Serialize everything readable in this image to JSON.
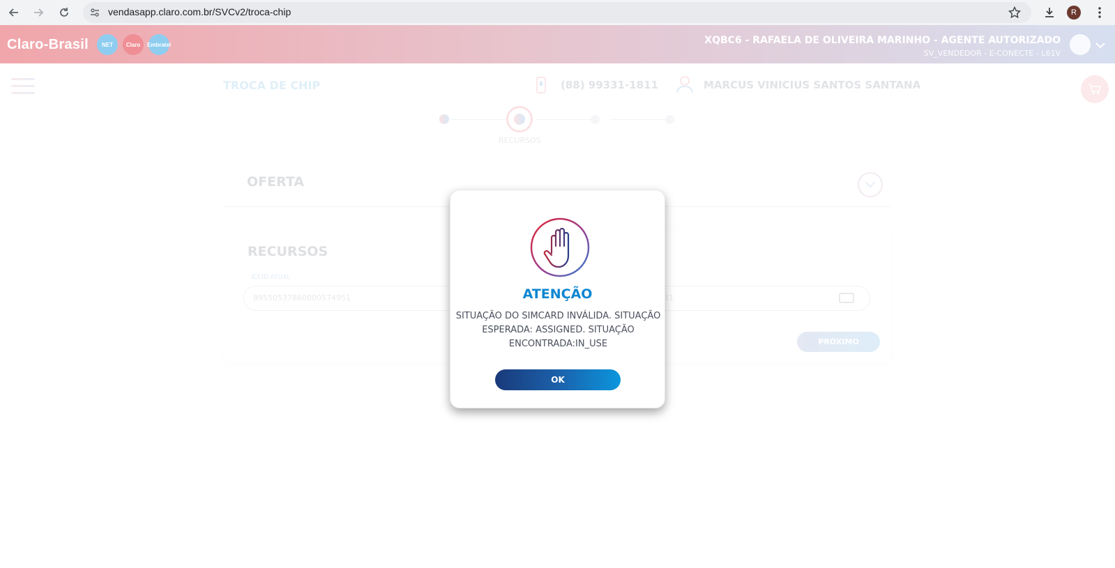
{
  "browser": {
    "url": "vendasapp.claro.com.br/SVCv2/troca-chip",
    "profile_initial": "R"
  },
  "header": {
    "brand": "Claro-Brasil",
    "badges": [
      "NET",
      "Claro",
      "Embratel"
    ],
    "agent_name": "XQBC6 - RAFAELA DE OLIVEIRA MARINHO - AGENTE AUTORIZADO",
    "agent_role": "SV_VENDEDOR - E-CONECTE - L61V"
  },
  "page": {
    "flow_title": "TROCA DE CHIP",
    "phone": "(88) 99331-1811",
    "customer": "MARCUS VINICIUS SANTOS SANTANA",
    "step_label": "RECURSOS",
    "offer_title": "OFERTA",
    "resources_title": "RECURSOS",
    "iccid_label": "ICCID ATUAL",
    "iccid_value": "89550537860000574951",
    "new_iccid_value": "51",
    "next_label": "PRÓXIMO"
  },
  "modal": {
    "title": "ATENÇÃO",
    "message": "SITUAÇÃO DO SIMCARD INVÁLIDA. SITUAÇÃO ESPERADA: ASSIGNED. SITUAÇÃO ENCONTRADA:IN_USE",
    "ok_label": "OK",
    "icon": "stop-hand-icon"
  },
  "colors": {
    "accent_blue": "#0e87d1",
    "brand_red": "#da291c",
    "button_dark": "#1a3a7a"
  }
}
